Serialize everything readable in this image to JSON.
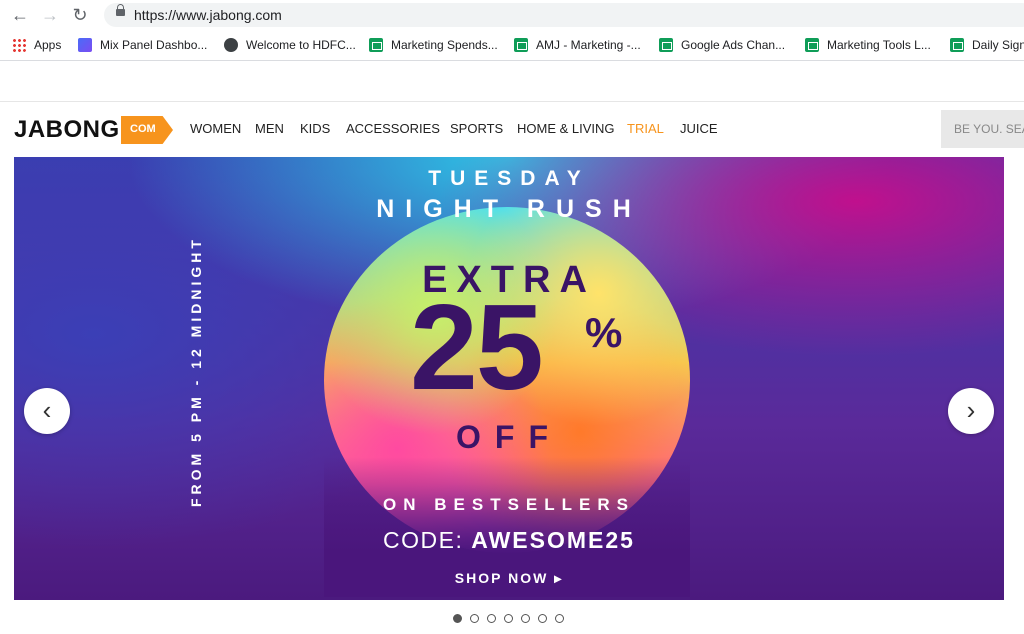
{
  "browser": {
    "back_icon": "arrow-left-icon",
    "forward_icon": "arrow-right-icon",
    "reload_icon": "reload-icon",
    "url": "https://www.jabong.com",
    "bookmarks": [
      {
        "label": "Apps",
        "icon": "apps-grid-icon"
      },
      {
        "label": "Mix Panel Dashbo...",
        "icon": "mixpanel-icon"
      },
      {
        "label": "Welcome to HDFC...",
        "icon": "globe-icon"
      },
      {
        "label": "Marketing Spends...",
        "icon": "sheets-icon"
      },
      {
        "label": "AMJ - Marketing -...",
        "icon": "sheets-icon"
      },
      {
        "label": "Google Ads Chan...",
        "icon": "sheets-icon"
      },
      {
        "label": "Marketing Tools L...",
        "icon": "sheets-icon"
      },
      {
        "label": "Daily Sign",
        "icon": "sheets-icon"
      }
    ]
  },
  "site": {
    "logo_text": "JABONG",
    "logo_tag": "COM",
    "menu": [
      "WOMEN",
      "MEN",
      "KIDS",
      "ACCESSORIES",
      "SPORTS",
      "HOME & LIVING",
      "TRIAL",
      "JUICE"
    ],
    "search_placeholder": "BE YOU. SEA",
    "accent_color": "#f7941d"
  },
  "banner": {
    "line1": "TUESDAY",
    "line2": "NIGHT RUSH",
    "extra": "EXTRA",
    "amount": "25",
    "percent": "%",
    "off": "OFF",
    "timing": "FROM 5 PM - 12 MIDNIGHT",
    "on_bestsellers": "ON BESTSELLERS",
    "code_label": "CODE:",
    "code_value": "AWESOME25",
    "cta": "SHOP NOW",
    "cta_arrow": "▸"
  },
  "carousel": {
    "prev_icon": "‹",
    "next_icon": "›",
    "slide_count": 7,
    "active_slide": 1
  }
}
